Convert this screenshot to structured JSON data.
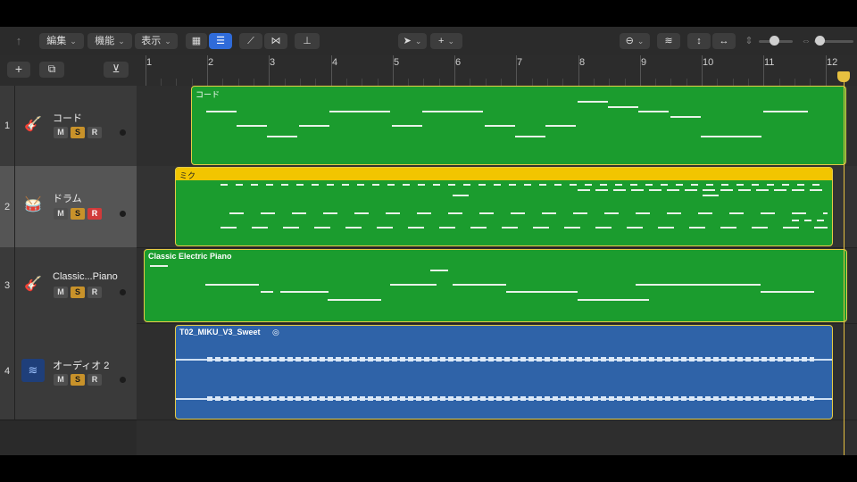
{
  "toolbar": {
    "back_icon": "arrow-up-icon",
    "menus": [
      {
        "label": "編集"
      },
      {
        "label": "機能"
      },
      {
        "label": "表示"
      }
    ]
  },
  "ruler": {
    "bars": [
      "1",
      "2",
      "3",
      "4",
      "5",
      "6",
      "7",
      "8",
      "9",
      "10",
      "11",
      "12"
    ]
  },
  "tracks": [
    {
      "number": "1",
      "name": "コード",
      "icon": "guitar-icon",
      "m": "M",
      "s": "S",
      "r": "R",
      "record_armed": false
    },
    {
      "number": "2",
      "name": "ドラム",
      "icon": "drum-kit-icon",
      "m": "M",
      "s": "S",
      "r": "R",
      "record_armed": true
    },
    {
      "number": "3",
      "name": "Classic...Piano",
      "icon": "electric-guitar-icon",
      "m": "M",
      "s": "S",
      "r": "R",
      "record_armed": false
    },
    {
      "number": "4",
      "name": "オーディオ 2",
      "icon": "waveform-icon",
      "m": "M",
      "s": "S",
      "r": "R",
      "record_armed": false
    }
  ],
  "regions": [
    {
      "name": "コード",
      "type": "midi",
      "color": "#1b9c2e"
    },
    {
      "name": "ミク",
      "type": "drummer",
      "color": "#f2c500"
    },
    {
      "name": "Classic Electric Piano",
      "type": "midi",
      "color": "#1b9c2e"
    },
    {
      "name": "T02_MIKU_V3_Sweet",
      "type": "audio",
      "color": "#2f63a8"
    }
  ],
  "colors": {
    "accent": "#2f6bd9",
    "solo": "#c8922a",
    "record": "#d13a3a",
    "playhead": "#e6c040"
  }
}
